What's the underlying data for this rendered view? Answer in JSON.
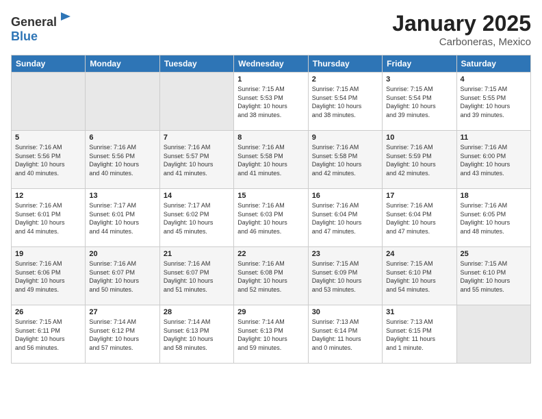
{
  "header": {
    "logo_general": "General",
    "logo_blue": "Blue",
    "month": "January 2025",
    "location": "Carboneras, Mexico"
  },
  "days_of_week": [
    "Sunday",
    "Monday",
    "Tuesday",
    "Wednesday",
    "Thursday",
    "Friday",
    "Saturday"
  ],
  "weeks": [
    [
      {
        "day": "",
        "info": ""
      },
      {
        "day": "",
        "info": ""
      },
      {
        "day": "",
        "info": ""
      },
      {
        "day": "1",
        "info": "Sunrise: 7:15 AM\nSunset: 5:53 PM\nDaylight: 10 hours\nand 38 minutes."
      },
      {
        "day": "2",
        "info": "Sunrise: 7:15 AM\nSunset: 5:54 PM\nDaylight: 10 hours\nand 38 minutes."
      },
      {
        "day": "3",
        "info": "Sunrise: 7:15 AM\nSunset: 5:54 PM\nDaylight: 10 hours\nand 39 minutes."
      },
      {
        "day": "4",
        "info": "Sunrise: 7:15 AM\nSunset: 5:55 PM\nDaylight: 10 hours\nand 39 minutes."
      }
    ],
    [
      {
        "day": "5",
        "info": "Sunrise: 7:16 AM\nSunset: 5:56 PM\nDaylight: 10 hours\nand 40 minutes."
      },
      {
        "day": "6",
        "info": "Sunrise: 7:16 AM\nSunset: 5:56 PM\nDaylight: 10 hours\nand 40 minutes."
      },
      {
        "day": "7",
        "info": "Sunrise: 7:16 AM\nSunset: 5:57 PM\nDaylight: 10 hours\nand 41 minutes."
      },
      {
        "day": "8",
        "info": "Sunrise: 7:16 AM\nSunset: 5:58 PM\nDaylight: 10 hours\nand 41 minutes."
      },
      {
        "day": "9",
        "info": "Sunrise: 7:16 AM\nSunset: 5:58 PM\nDaylight: 10 hours\nand 42 minutes."
      },
      {
        "day": "10",
        "info": "Sunrise: 7:16 AM\nSunset: 5:59 PM\nDaylight: 10 hours\nand 42 minutes."
      },
      {
        "day": "11",
        "info": "Sunrise: 7:16 AM\nSunset: 6:00 PM\nDaylight: 10 hours\nand 43 minutes."
      }
    ],
    [
      {
        "day": "12",
        "info": "Sunrise: 7:16 AM\nSunset: 6:01 PM\nDaylight: 10 hours\nand 44 minutes."
      },
      {
        "day": "13",
        "info": "Sunrise: 7:17 AM\nSunset: 6:01 PM\nDaylight: 10 hours\nand 44 minutes."
      },
      {
        "day": "14",
        "info": "Sunrise: 7:17 AM\nSunset: 6:02 PM\nDaylight: 10 hours\nand 45 minutes."
      },
      {
        "day": "15",
        "info": "Sunrise: 7:16 AM\nSunset: 6:03 PM\nDaylight: 10 hours\nand 46 minutes."
      },
      {
        "day": "16",
        "info": "Sunrise: 7:16 AM\nSunset: 6:04 PM\nDaylight: 10 hours\nand 47 minutes."
      },
      {
        "day": "17",
        "info": "Sunrise: 7:16 AM\nSunset: 6:04 PM\nDaylight: 10 hours\nand 47 minutes."
      },
      {
        "day": "18",
        "info": "Sunrise: 7:16 AM\nSunset: 6:05 PM\nDaylight: 10 hours\nand 48 minutes."
      }
    ],
    [
      {
        "day": "19",
        "info": "Sunrise: 7:16 AM\nSunset: 6:06 PM\nDaylight: 10 hours\nand 49 minutes."
      },
      {
        "day": "20",
        "info": "Sunrise: 7:16 AM\nSunset: 6:07 PM\nDaylight: 10 hours\nand 50 minutes."
      },
      {
        "day": "21",
        "info": "Sunrise: 7:16 AM\nSunset: 6:07 PM\nDaylight: 10 hours\nand 51 minutes."
      },
      {
        "day": "22",
        "info": "Sunrise: 7:16 AM\nSunset: 6:08 PM\nDaylight: 10 hours\nand 52 minutes."
      },
      {
        "day": "23",
        "info": "Sunrise: 7:15 AM\nSunset: 6:09 PM\nDaylight: 10 hours\nand 53 minutes."
      },
      {
        "day": "24",
        "info": "Sunrise: 7:15 AM\nSunset: 6:10 PM\nDaylight: 10 hours\nand 54 minutes."
      },
      {
        "day": "25",
        "info": "Sunrise: 7:15 AM\nSunset: 6:10 PM\nDaylight: 10 hours\nand 55 minutes."
      }
    ],
    [
      {
        "day": "26",
        "info": "Sunrise: 7:15 AM\nSunset: 6:11 PM\nDaylight: 10 hours\nand 56 minutes."
      },
      {
        "day": "27",
        "info": "Sunrise: 7:14 AM\nSunset: 6:12 PM\nDaylight: 10 hours\nand 57 minutes."
      },
      {
        "day": "28",
        "info": "Sunrise: 7:14 AM\nSunset: 6:13 PM\nDaylight: 10 hours\nand 58 minutes."
      },
      {
        "day": "29",
        "info": "Sunrise: 7:14 AM\nSunset: 6:13 PM\nDaylight: 10 hours\nand 59 minutes."
      },
      {
        "day": "30",
        "info": "Sunrise: 7:13 AM\nSunset: 6:14 PM\nDaylight: 11 hours\nand 0 minutes."
      },
      {
        "day": "31",
        "info": "Sunrise: 7:13 AM\nSunset: 6:15 PM\nDaylight: 11 hours\nand 1 minute."
      },
      {
        "day": "",
        "info": ""
      }
    ]
  ]
}
